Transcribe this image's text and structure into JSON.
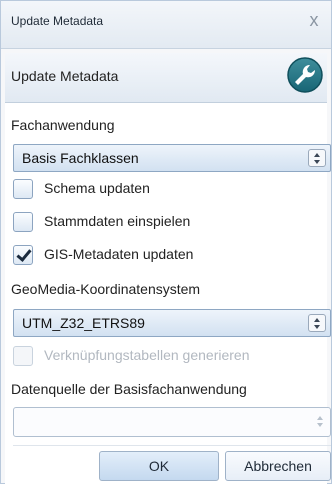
{
  "window": {
    "title": "Update Metadata",
    "close_glyph": "x"
  },
  "header": {
    "title": "Update Metadata",
    "icon": "wrench-icon"
  },
  "form": {
    "fachanwendung_label": "Fachanwendung",
    "fachanwendung_value": "Basis Fachklassen",
    "schema_update": {
      "label": "Schema updaten",
      "checked": false
    },
    "stammdaten": {
      "label": "Stammdaten einspielen",
      "checked": false
    },
    "gis_metadaten": {
      "label": "GIS-Metadaten updaten",
      "checked": true
    },
    "koordinatensystem_label": "GeoMedia-Koordinatensystem",
    "koordinatensystem_value": "UTM_Z32_ETRS89",
    "verknuepfung": {
      "label": "Verknüpfungstabellen generieren",
      "checked": false,
      "disabled": true
    },
    "datenquelle_label": "Datenquelle der Basisfachanwendung",
    "datenquelle_value": ""
  },
  "buttons": {
    "ok": "OK",
    "cancel": "Abbrechen"
  }
}
